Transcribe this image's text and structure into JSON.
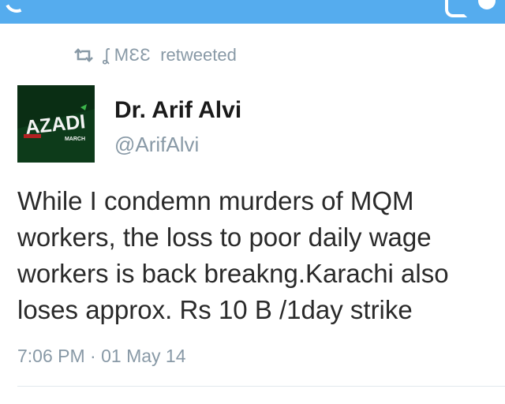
{
  "colors": {
    "top_bar": "#55acee",
    "muted_text": "#8899a6",
    "primary_text": "#1a1a1a",
    "avatar_bg": "#0d3b1a",
    "divider": "#e1e8ed"
  },
  "retweet": {
    "icon": "retweet-icon",
    "user": "ʆ MƐƐ",
    "label": "retweeted"
  },
  "tweet": {
    "avatar_text": "AZADI",
    "avatar_subtext": "MARCH",
    "author_name": "Dr. Arif Alvi",
    "author_handle": "@ArifAlvi",
    "text": "While I condemn murders of MQM workers, the loss to poor daily wage workers is back breakng.Karachi also loses approx.  Rs 10 B /1day strike",
    "time": "7:06 PM",
    "date_separator": "·",
    "date": "01 May 14"
  }
}
